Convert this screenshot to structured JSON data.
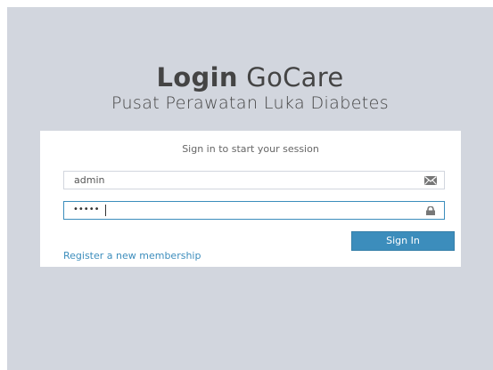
{
  "logo": {
    "bold": "Login",
    "light": " GoCare",
    "subtitle": "Pusat Perawatan Luka Diabetes"
  },
  "login": {
    "message": "Sign in to start your session",
    "username_value": "admin",
    "password_masked": "•••••",
    "signin_label": "Sign In",
    "register_label": "Register a new membership"
  },
  "icons": {
    "username": "envelope-icon",
    "password": "lock-icon"
  },
  "colors": {
    "page_bg": "#d2d6de",
    "accent": "#3c8dbc"
  }
}
